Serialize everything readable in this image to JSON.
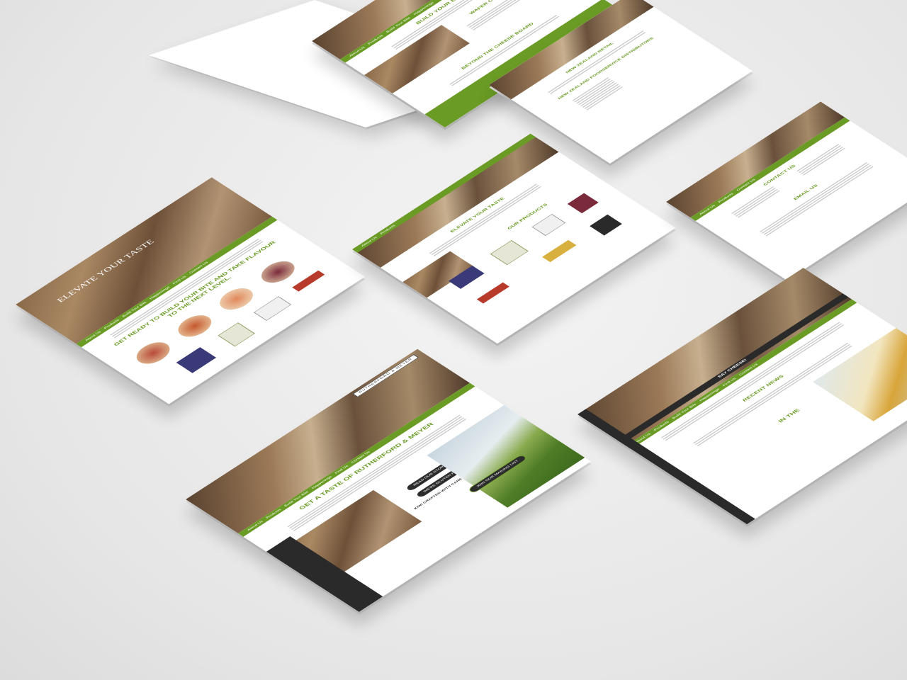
{
  "nav": {
    "items": [
      "About Us",
      "Products",
      "Build Your Bite",
      "Happenings",
      "Find Us",
      "Contact Us"
    ]
  },
  "brand": {
    "logo_text": "RUTHERFORD & MEYER",
    "accent": "#6a9b24",
    "dark": "#2a2a2a"
  },
  "home": {
    "hero_title": "ELEVATE YOUR TASTE",
    "headline": "GET READY TO BUILD YOUR BITE AND TAKE FLAVOUR TO THE NEXT LEVEL."
  },
  "build": {
    "title": "BUILD YOUR BITE",
    "wafer_title": "WAFER COMBINATIONS",
    "board_title": "BEYOND THE CHEESE BOARD"
  },
  "retail": {
    "title1": "NEW ZEALAND RETAIL",
    "title2": "NEW ZEALAND FOODSERVICE DISTRIBUTORS"
  },
  "products": {
    "title": "ELEVATE YOUR TASTE",
    "section": "OUR PRODUCTS"
  },
  "contact": {
    "title": "CONTACT US",
    "email": "EMAIL US"
  },
  "about": {
    "headline": "GET A TASTE OF RUTHERFORD & MEYER",
    "read_btn": "READ OUR STORY",
    "gf_btn": "WE'RE GLUTEN FREE",
    "badge": "GLUTEN FREE",
    "kiwi": "KIWI CRAFTED WITH CARE",
    "mailing": "JOIN OUR MAILING LIST"
  },
  "news": {
    "title": "SAY CHEESE!",
    "recent": "RECENT NEWS",
    "side": "IN THE"
  }
}
